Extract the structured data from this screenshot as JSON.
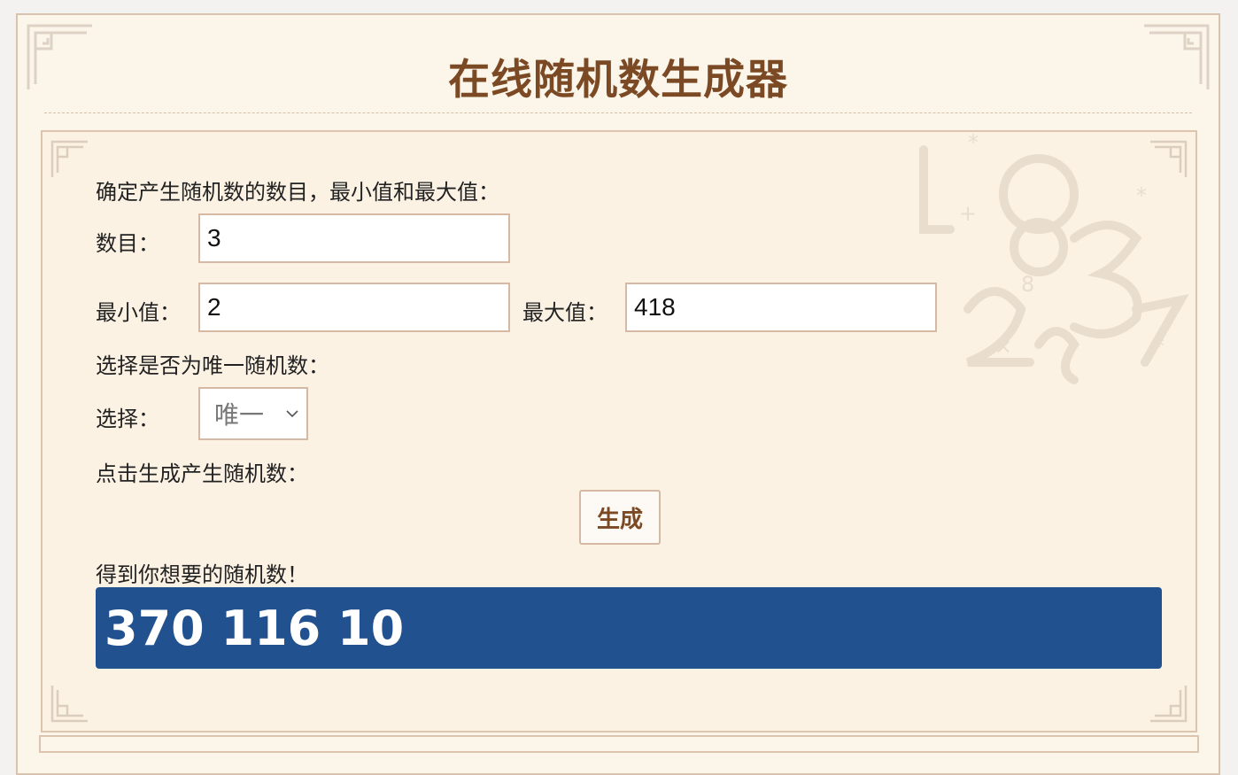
{
  "header": {
    "title": "在线随机数生成器"
  },
  "form": {
    "intro_label": "确定产生随机数的数目，最小值和最大值：",
    "count_label": "数目：",
    "count_value": "3",
    "min_label": "最小值：",
    "min_value": "2",
    "max_label": "最大值：",
    "max_value": "418",
    "unique_prompt": "选择是否为唯一随机数：",
    "select_label": "选择：",
    "select_value": "唯一",
    "generate_prompt": "点击生成产生随机数：",
    "generate_button": "生成",
    "result_prompt": "得到你想要的随机数！",
    "result_value": "370 116 10"
  },
  "colors": {
    "title": "#7b4a25",
    "result_bg": "#22518f",
    "border": "#d6b9a5"
  },
  "icons": {
    "select_arrow": "chevron-down-icon"
  }
}
